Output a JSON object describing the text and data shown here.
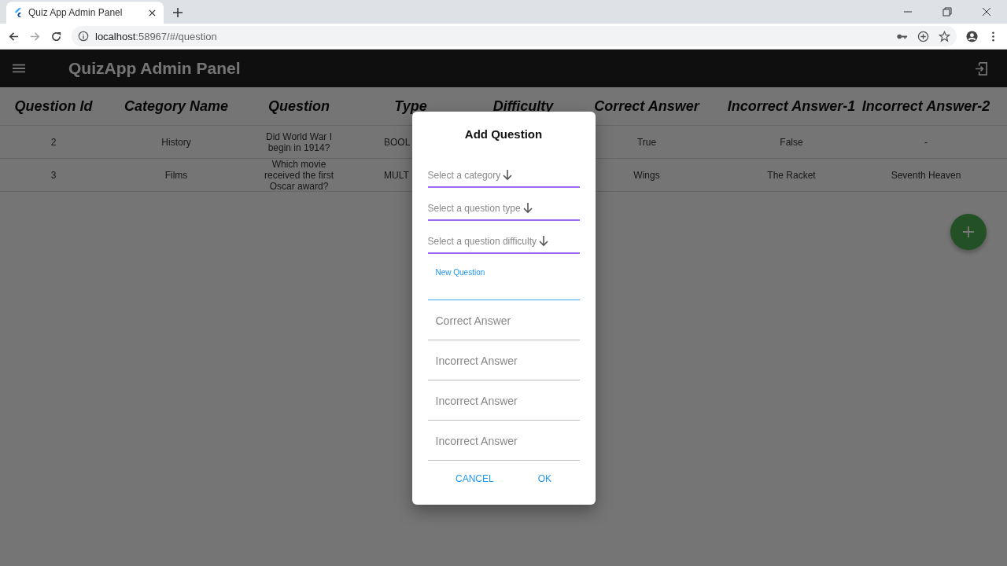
{
  "browser": {
    "tab_title": "Quiz App Admin Panel",
    "address_host": "localhost",
    "address_path": ":58967/#/question"
  },
  "app_bar": {
    "title": "QuizApp Admin Panel"
  },
  "table": {
    "columns": [
      "Question Id",
      "Category Name",
      "Question",
      "Type",
      "Difficulty",
      "Correct Answer",
      "Incorrect Answer-1",
      "Incorrect Answer-2"
    ],
    "rows": [
      [
        "2",
        "History",
        "Did World War I begin in 1914?",
        "BOOL",
        "",
        "True",
        "False",
        "-"
      ],
      [
        "3",
        "Films",
        "Which movie received the first Oscar award?",
        "MULT",
        "",
        "Wings",
        "The Racket",
        "Seventh Heaven"
      ]
    ]
  },
  "dialog": {
    "title": "Add Question",
    "fields": [
      {
        "kind": "dropdown",
        "placeholder": "Select a category"
      },
      {
        "kind": "dropdown",
        "placeholder": "Select a question type"
      },
      {
        "kind": "dropdown",
        "placeholder": "Select a question difficulty"
      },
      {
        "kind": "text",
        "label": "New Question",
        "focused": true
      },
      {
        "kind": "text",
        "placeholder": "Correct Answer",
        "focused": false
      },
      {
        "kind": "text",
        "placeholder": "Incorrect Answer",
        "focused": false
      },
      {
        "kind": "text",
        "placeholder": "Incorrect Answer",
        "focused": false
      },
      {
        "kind": "text",
        "placeholder": "Incorrect Answer",
        "focused": false
      }
    ],
    "buttons": [
      "CANCEL",
      "OK"
    ]
  }
}
